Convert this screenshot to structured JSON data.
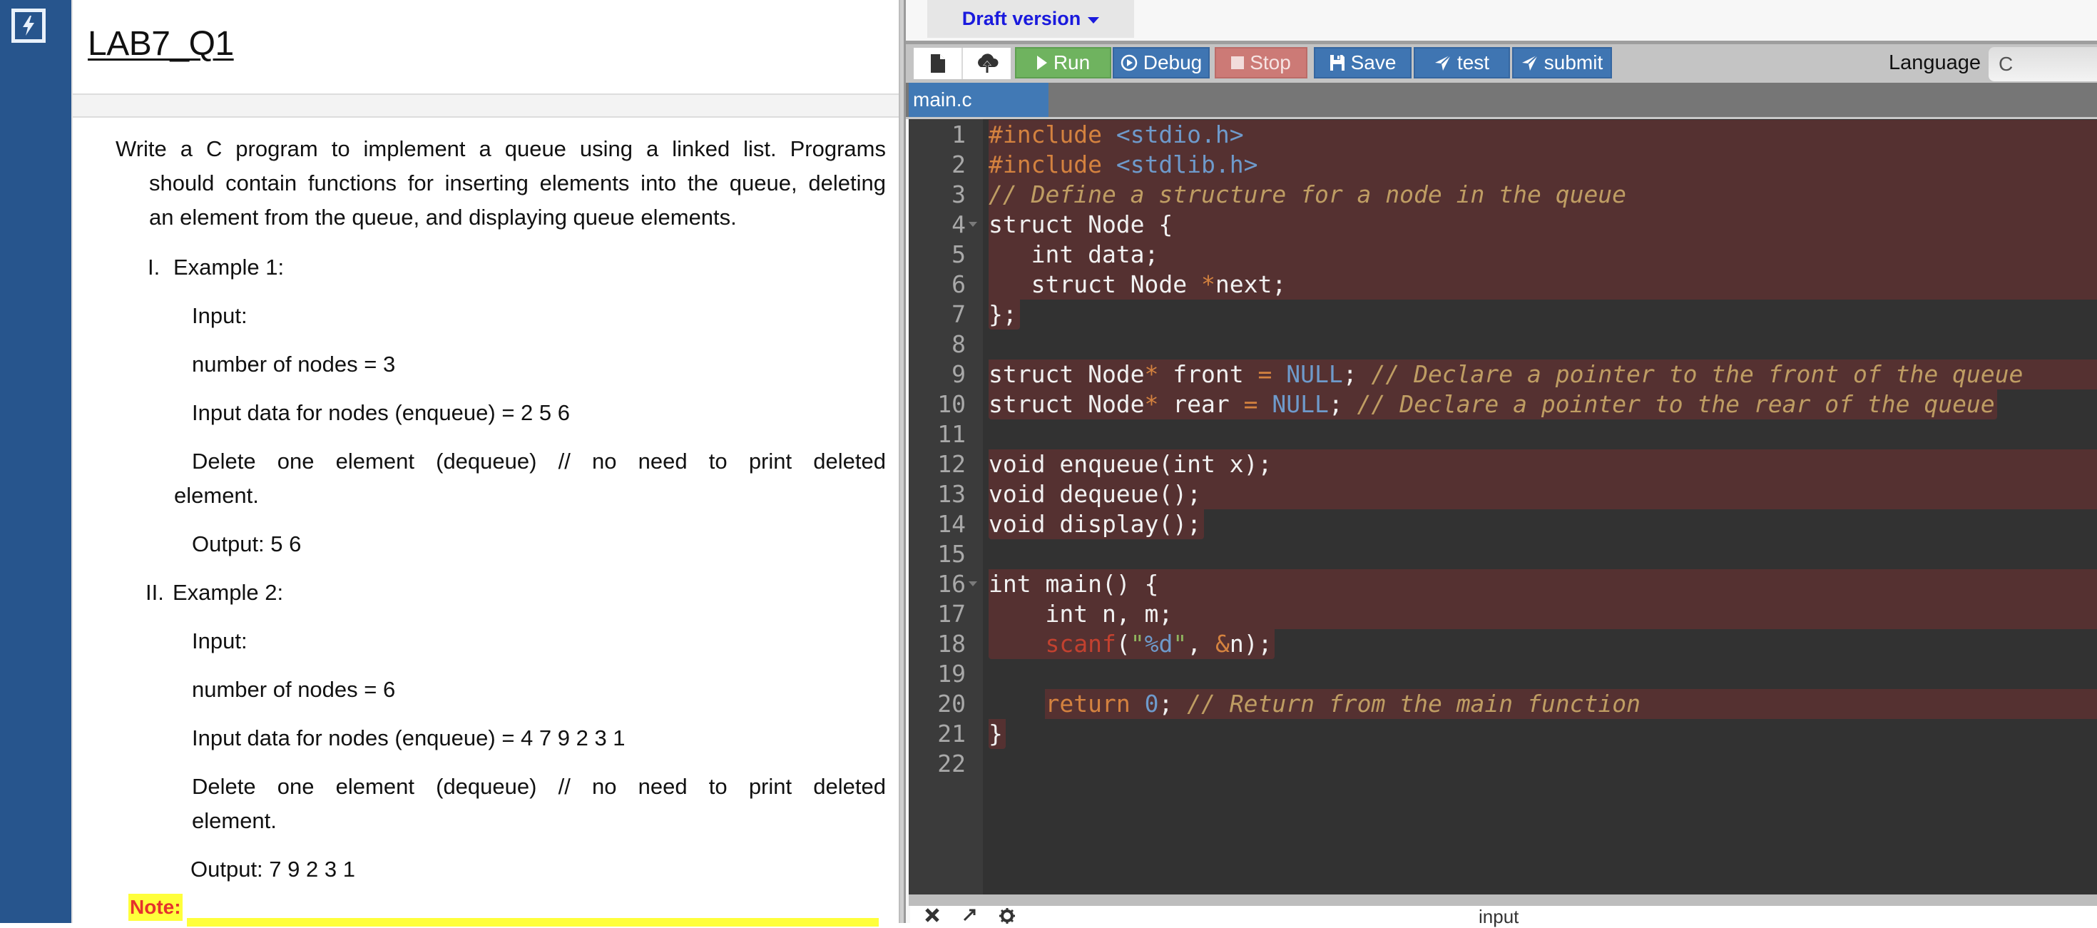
{
  "app": {
    "logo_icon": "lightning-bolt-icon"
  },
  "problem": {
    "title": "LAB7_Q1",
    "intro_lines": [
      "Write a C program to implement a queue using a linked list. Programs",
      "should contain functions for inserting elements into the queue, deleting",
      "an element from the queue, and displaying queue elements."
    ],
    "examples": [
      {
        "numeral": "I.",
        "heading": "Example 1:",
        "input_label": "Input:",
        "nodes": "number of nodes = 3",
        "data": "Input data for nodes (enqueue) = 2 5 6",
        "delete_line1": "Delete one element (dequeue) // no need to print deleted",
        "delete_line2": "element.",
        "output": "Output: 5 6"
      },
      {
        "numeral": "II.",
        "heading": "Example 2:",
        "input_label": "Input:",
        "nodes": "number of nodes = 6",
        "data": "Input data for nodes (enqueue) = 4 7 9 2 3 1",
        "delete_line1": "Delete one element (dequeue) // no need to print deleted",
        "delete_line2": "element.",
        "output": "Output: 7 9 2 3 1"
      }
    ],
    "note_label": "Note:"
  },
  "ide": {
    "version_dropdown": "Draft version",
    "toolbar": {
      "new_file_icon": "file-icon",
      "upload_icon": "cloud-upload-icon",
      "run": "Run",
      "debug": "Debug",
      "stop": "Stop",
      "save": "Save",
      "test": "test",
      "submit": "submit",
      "language_label": "Language",
      "language_value": "C"
    },
    "tabs": [
      {
        "label": "main.c",
        "active": true
      }
    ],
    "code_lines": [
      "#include <stdio.h>",
      "#include <stdlib.h>",
      "// Define a structure for a node in the queue",
      "struct Node {",
      "   int data;",
      "   struct Node *next;",
      "};",
      "",
      "struct Node* front = NULL; // Declare a pointer to the front of the queue",
      "struct Node* rear = NULL; // Declare a pointer to the rear of the queue",
      "",
      "void enqueue(int x);",
      "void dequeue();",
      "void display();",
      "",
      "int main() {",
      "    int n, m;",
      "    scanf(\"%d\", &n);",
      "",
      "    return 0; // Return from the main function",
      "}",
      ""
    ],
    "console": {
      "title": "input",
      "icons": [
        "close-icon",
        "expand-icon",
        "settings-gear-icon"
      ]
    },
    "colors": {
      "run": "#6fb35f",
      "primary": "#3f75b2",
      "stop": "#cc7a76",
      "highlight": "#553131",
      "editor_bg": "#323232"
    }
  }
}
